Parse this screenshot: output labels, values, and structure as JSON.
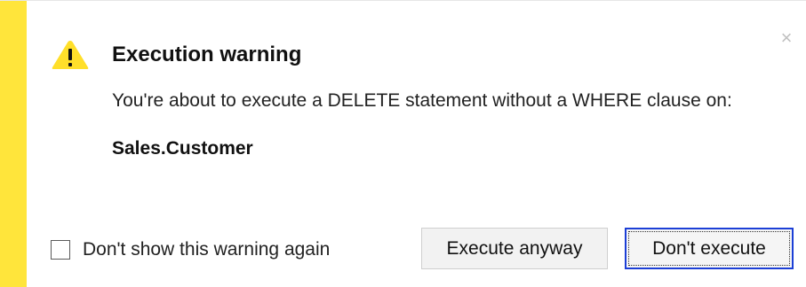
{
  "dialog": {
    "title": "Execution warning",
    "message": "You're about to execute a DELETE statement without a WHERE clause on:",
    "target_object": "Sales.Customer",
    "close_glyph": "×",
    "warning_icon": "warning-triangle-icon",
    "close_icon": "close-icon",
    "checkbox": {
      "label": "Don't show this warning again",
      "checked": false
    },
    "buttons": {
      "execute_anyway": "Execute anyway",
      "dont_execute": "Don't execute"
    },
    "colors": {
      "accent": "#ffe53b",
      "warning_icon": "#ffdf2a",
      "focus_border": "#1c3fd6"
    }
  }
}
